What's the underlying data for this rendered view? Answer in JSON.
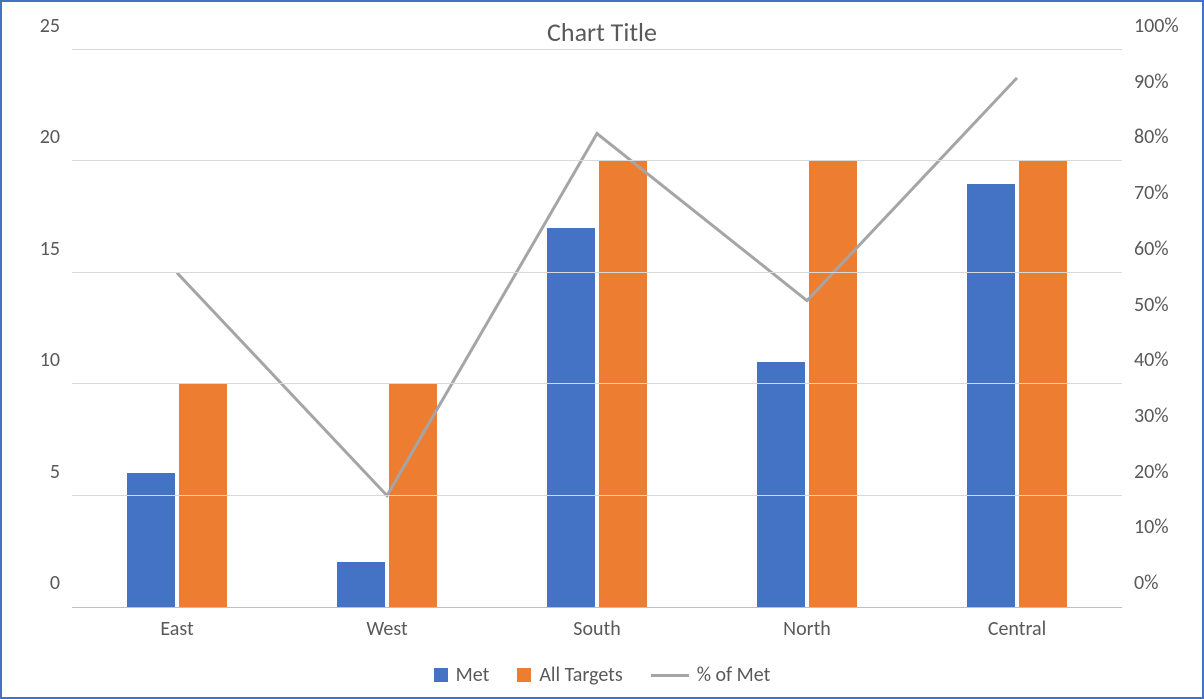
{
  "chart_data": {
    "type": "bar",
    "title": "Chart Title",
    "categories": [
      "East",
      "West",
      "South",
      "North",
      "Central"
    ],
    "series": [
      {
        "name": "Met",
        "values": [
          6,
          2,
          17,
          11,
          19
        ],
        "axis": "left",
        "kind": "bar",
        "color": "#4472c4"
      },
      {
        "name": "All Targets",
        "values": [
          10,
          10,
          20,
          20,
          20
        ],
        "axis": "left",
        "kind": "bar",
        "color": "#ed7d31"
      },
      {
        "name": "% of Met",
        "values": [
          60,
          20,
          85,
          55,
          95
        ],
        "axis": "right",
        "kind": "line",
        "color": "#a5a5a5"
      }
    ],
    "y_left": {
      "min": 0,
      "max": 25,
      "ticks": [
        0,
        5,
        10,
        15,
        20,
        25
      ]
    },
    "y_right": {
      "min": 0,
      "max": 100,
      "ticks": [
        0,
        10,
        20,
        30,
        40,
        50,
        60,
        70,
        80,
        90,
        100
      ],
      "suffix": "%"
    },
    "legend": [
      "Met",
      "All Targets",
      "% of Met"
    ]
  }
}
